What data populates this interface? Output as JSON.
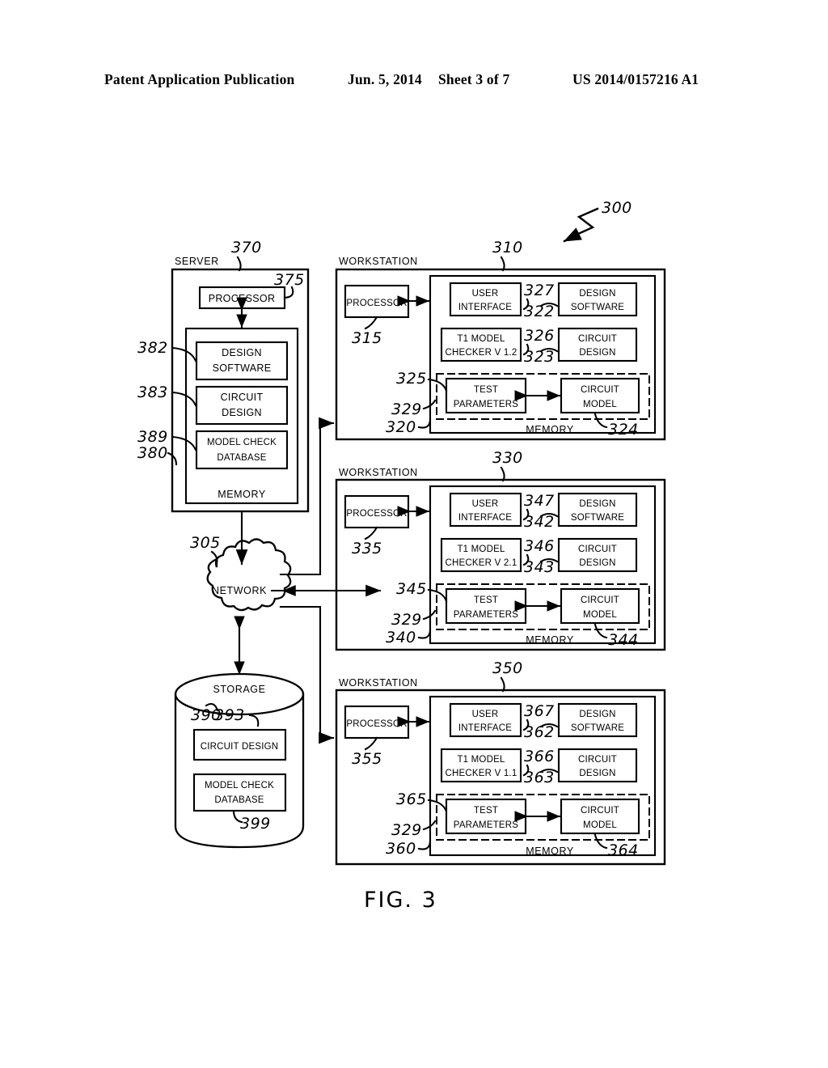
{
  "header": {
    "publication": "Patent Application Publication",
    "date": "Jun. 5, 2014",
    "sheet": "Sheet 3 of 7",
    "patent_number": "US 2014/0157216 A1"
  },
  "figure": {
    "caption": "FIG. 3",
    "system_ref": "300"
  },
  "server": {
    "title": "SERVER",
    "ref": "370",
    "processor": {
      "label": "PROCESSOR",
      "ref": "375"
    },
    "memory": {
      "label": "MEMORY",
      "ref": "380",
      "items": [
        {
          "label_line1": "DESIGN",
          "label_line2": "SOFTWARE",
          "ref": "382"
        },
        {
          "label_line1": "CIRCUIT",
          "label_line2": "DESIGN",
          "ref": "383"
        },
        {
          "label_line1": "MODEL CHECK",
          "label_line2": "DATABASE",
          "ref": "389"
        }
      ]
    }
  },
  "network": {
    "label": "NETWORK",
    "ref": "305"
  },
  "storage": {
    "label": "STORAGE",
    "ref": "390",
    "items": [
      {
        "label_line1": "CIRCUIT DESIGN",
        "label_line2": "",
        "ref": "393"
      },
      {
        "label_line1": "MODEL CHECK",
        "label_line2": "DATABASE",
        "ref": "399"
      }
    ]
  },
  "workstations": [
    {
      "title": "WORKSTATION",
      "ref": "310",
      "processor": {
        "label": "PROCESSOR",
        "ref": "315"
      },
      "memory": {
        "label": "MEMORY",
        "ref": "320",
        "user_interface": {
          "line1": "USER",
          "line2": "INTERFACE",
          "ref": "327"
        },
        "design_software": {
          "line1": "DESIGN",
          "line2": "SOFTWARE",
          "ref": "322"
        },
        "model_checker": {
          "line1": "T1 MODEL",
          "line2": "CHECKER V 1.2",
          "ref": "326"
        },
        "circuit_design": {
          "line1": "CIRCUIT",
          "line2": "DESIGN",
          "ref": "323"
        },
        "test_parameters": {
          "line1": "TEST",
          "line2": "PARAMETERS",
          "ref": "325"
        },
        "circuit_model": {
          "line1": "CIRCUIT",
          "line2": "MODEL",
          "ref": "324"
        },
        "dashed_group_ref": "329"
      }
    },
    {
      "title": "WORKSTATION",
      "ref": "330",
      "processor": {
        "label": "PROCESSOR",
        "ref": "335"
      },
      "memory": {
        "label": "MEMORY",
        "ref": "340",
        "user_interface": {
          "line1": "USER",
          "line2": "INTERFACE",
          "ref": "347"
        },
        "design_software": {
          "line1": "DESIGN",
          "line2": "SOFTWARE",
          "ref": "342"
        },
        "model_checker": {
          "line1": "T1 MODEL",
          "line2": "CHECKER V 2.1",
          "ref": "346"
        },
        "circuit_design": {
          "line1": "CIRCUIT",
          "line2": "DESIGN",
          "ref": "343"
        },
        "test_parameters": {
          "line1": "TEST",
          "line2": "PARAMETERS",
          "ref": "345"
        },
        "circuit_model": {
          "line1": "CIRCUIT",
          "line2": "MODEL",
          "ref": "344"
        },
        "dashed_group_ref": "329"
      }
    },
    {
      "title": "WORKSTATION",
      "ref": "350",
      "processor": {
        "label": "PROCESSOR",
        "ref": "355"
      },
      "memory": {
        "label": "MEMORY",
        "ref": "360",
        "user_interface": {
          "line1": "USER",
          "line2": "INTERFACE",
          "ref": "367"
        },
        "design_software": {
          "line1": "DESIGN",
          "line2": "SOFTWARE",
          "ref": "362"
        },
        "model_checker": {
          "line1": "T1 MODEL",
          "line2": "CHECKER V 1.1",
          "ref": "366"
        },
        "circuit_design": {
          "line1": "CIRCUIT",
          "line2": "DESIGN",
          "ref": "363"
        },
        "test_parameters": {
          "line1": "TEST",
          "line2": "PARAMETERS",
          "ref": "365"
        },
        "circuit_model": {
          "line1": "CIRCUIT",
          "line2": "MODEL",
          "ref": "364"
        },
        "dashed_group_ref": "329"
      }
    }
  ]
}
